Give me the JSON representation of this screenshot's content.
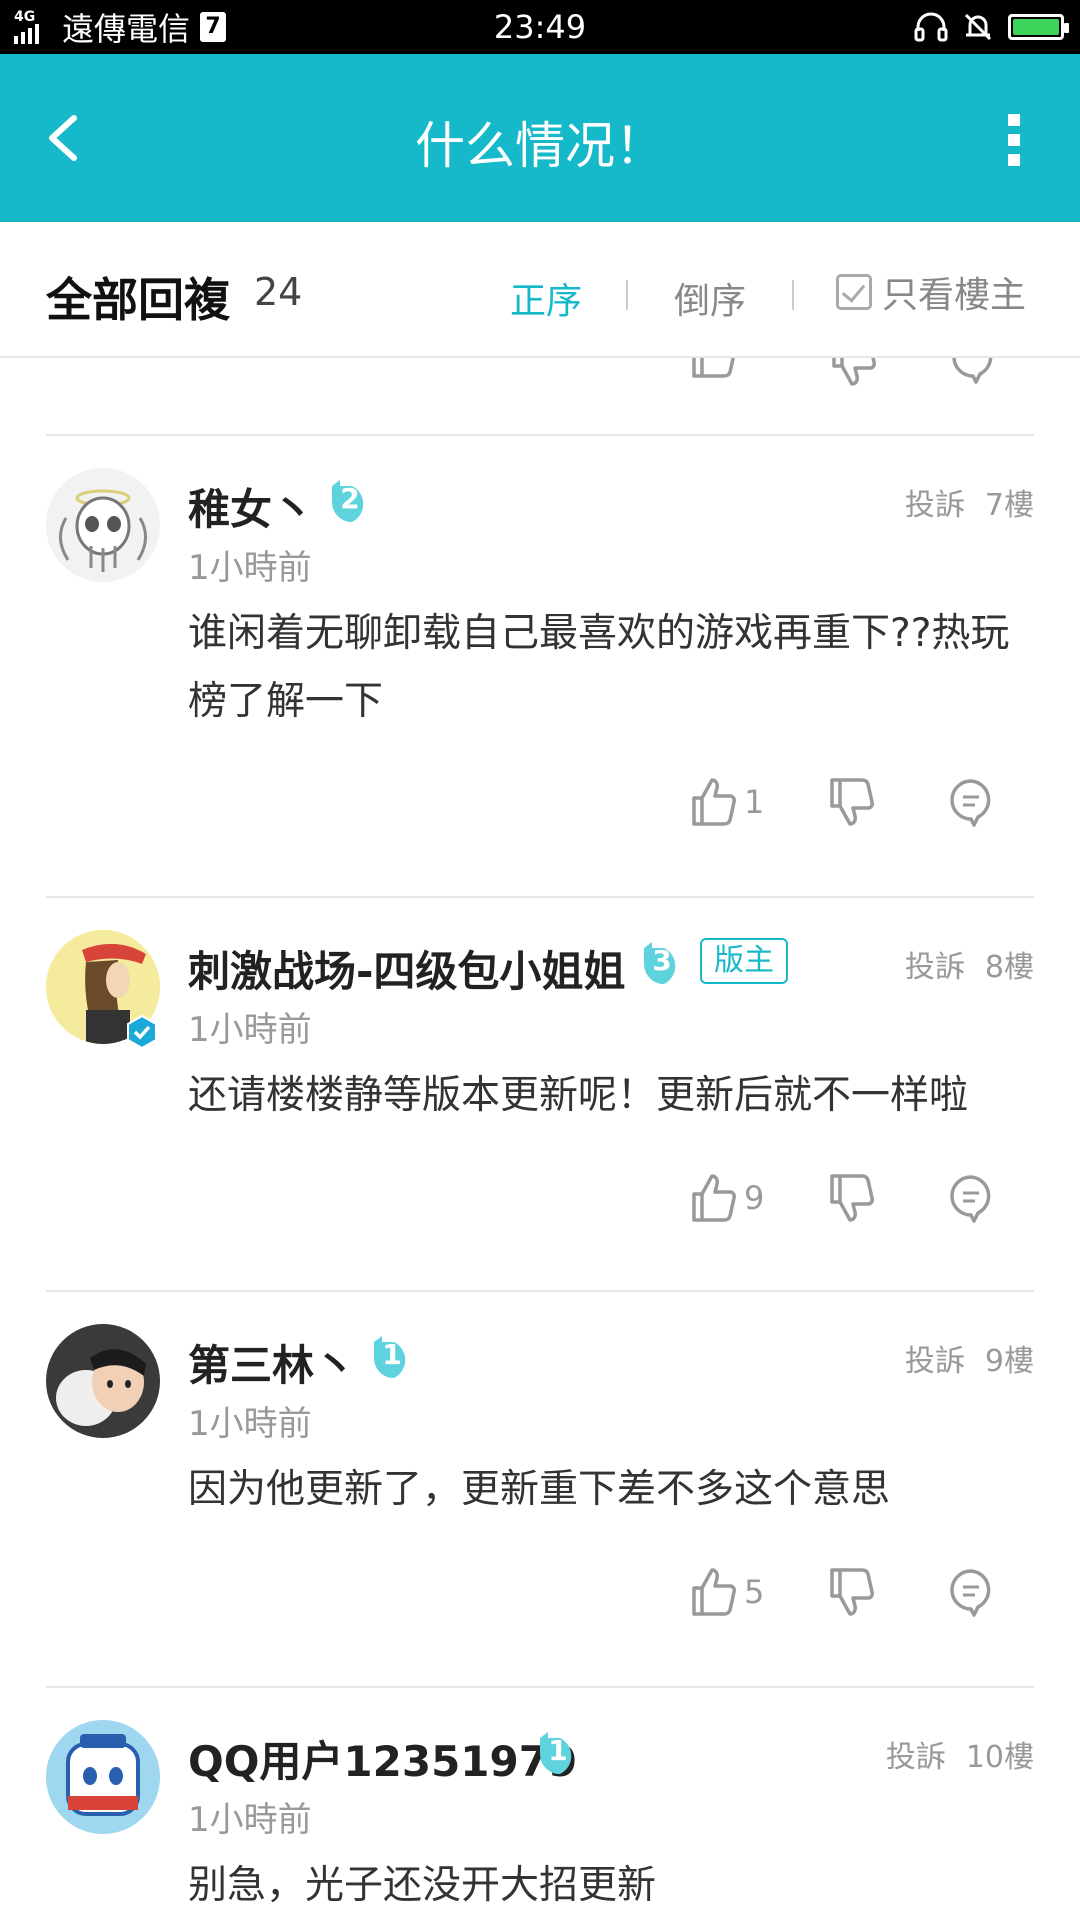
{
  "status_bar": {
    "network": "4G",
    "carrier": "遠傳電信",
    "sim_badge": "7",
    "time": "23:49",
    "icons": [
      "headset-icon",
      "bell-off-icon",
      "battery-charging-icon"
    ],
    "battery_level": 1.0
  },
  "app_bar": {
    "title": "什么情况！",
    "back_icon": "back-arrow-icon",
    "more_icon": "more-vertical-icon"
  },
  "sort_bar": {
    "title": "全部回複",
    "count": "24",
    "options": [
      "正序",
      "倒序"
    ],
    "selected": "正序",
    "only_host_label": "只看樓主",
    "only_host_checked": false
  },
  "comments": [
    {
      "username": "稚女丶",
      "level": "2",
      "moderator_label": "",
      "report_label": "投訴",
      "floor": "7樓",
      "time": "1小時前",
      "text": "谁闲着无聊卸载自己最喜欢的游戏再重下??热玩榜了解一下",
      "likes": "1"
    },
    {
      "username": "刺激战场-四级包小姐姐",
      "level": "3",
      "moderator_label": "版主",
      "verified": true,
      "report_label": "投訴",
      "floor": "8樓",
      "time": "1小時前",
      "text": "还请楼楼静等版本更新呢！更新后就不一样啦",
      "likes": "9"
    },
    {
      "username": "第三林丶",
      "level": "1",
      "moderator_label": "",
      "report_label": "投訴",
      "floor": "9樓",
      "time": "1小時前",
      "text": "因为他更新了，更新重下差不多这个意思",
      "likes": "5"
    },
    {
      "username": "QQ用户12351979",
      "level": "1",
      "moderator_label": "",
      "report_label": "投訴",
      "floor": "10樓",
      "time": "1小時前",
      "text": "别急，光子还没开大招更新",
      "likes": ""
    }
  ],
  "colors": {
    "accent": "#16b9c9",
    "level_badge": "#5fd3dd",
    "text_primary": "#222222",
    "text_secondary": "#999999"
  }
}
